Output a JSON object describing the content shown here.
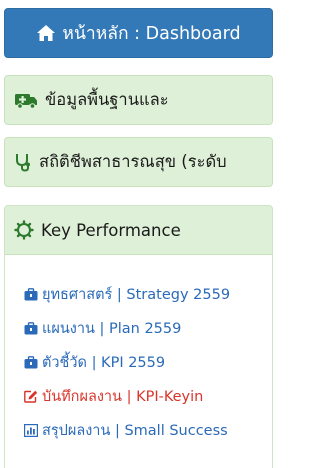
{
  "dashboard": {
    "label": "หน้าหลัก : Dashboard"
  },
  "panels": [
    {
      "label": "ข้อมูลพื้นฐานและ"
    },
    {
      "label": "สถิติชีพสาธารณสุข (ระดับ"
    }
  ],
  "kpi": {
    "title": "Key Performance",
    "items": [
      {
        "label": "ยุทธศาสตร์ | Strategy 2559"
      },
      {
        "label": "แผนงาน | Plan 2559"
      },
      {
        "label": "ตัวชี้วัด | KPI 2559"
      },
      {
        "label": "บันทึกผลงาน | KPI-Keyin"
      },
      {
        "label": "สรุปผลงาน | Small Success"
      }
    ]
  },
  "colors": {
    "primary": "#3379b8",
    "panel_bg": "#dff0d8",
    "link": "#2a6ab8",
    "active_link": "#d9342b"
  }
}
